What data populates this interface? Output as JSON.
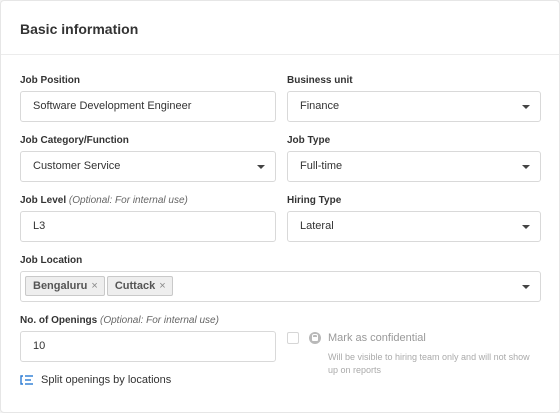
{
  "section": {
    "title": "Basic information"
  },
  "job_position": {
    "label": "Job Position",
    "value": "Software Development Engineer"
  },
  "business_unit": {
    "label": "Business unit",
    "value": "Finance"
  },
  "job_category": {
    "label": "Job Category/Function",
    "value": "Customer Service"
  },
  "job_type": {
    "label": "Job Type",
    "value": "Full-time"
  },
  "job_level": {
    "label": "Job Level",
    "optional_note": "(Optional: For internal use)",
    "value": "L3"
  },
  "hiring_type": {
    "label": "Hiring Type",
    "value": "Lateral"
  },
  "job_location": {
    "label": "Job Location",
    "tags": [
      "Bengaluru",
      "Cuttack"
    ],
    "remove_glyph": "×"
  },
  "openings": {
    "label": "No. of Openings",
    "optional_note": "(Optional: For internal use)",
    "value": "10"
  },
  "confidential": {
    "label": "Mark as confidential",
    "help": "Will be visible to hiring team only and will not show up on reports",
    "checked": false
  },
  "split_link": {
    "label": "Split openings by locations"
  },
  "colors": {
    "link_icon": "#2a7bd4",
    "border": "#d9d9d9"
  },
  "icons": {
    "select": "chevron-down-icon",
    "confidential": "lock-icon",
    "split": "split-list-icon"
  }
}
